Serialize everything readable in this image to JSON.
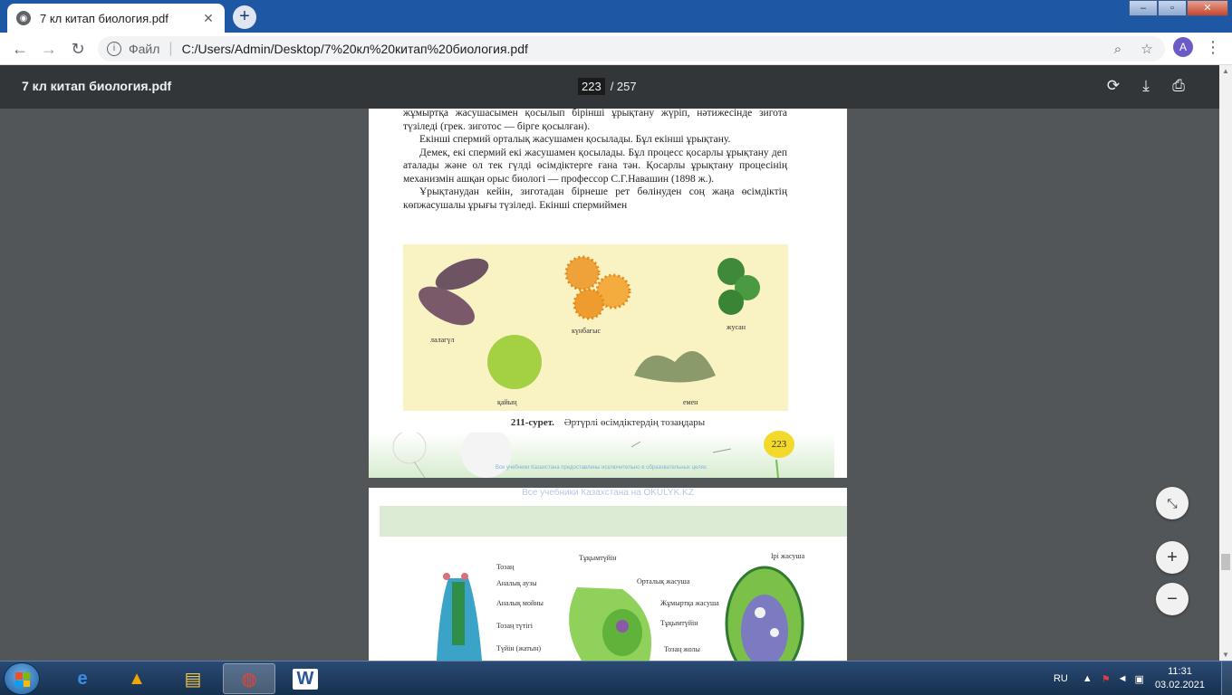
{
  "browser": {
    "tab_title": "7 кл китап биология.pdf",
    "tab_close": "✕",
    "new_tab": "+",
    "favicon": "globe-icon",
    "address_label": "Файл",
    "url": "C:/Users/Admin/Desktop/7%20кл%20китап%20биология.pdf",
    "avatar_letter": "A"
  },
  "pdf_viewer": {
    "file_name": "7 кл китап биология.pdf",
    "current_page": "223",
    "total_pages": "/ 257"
  },
  "page1": {
    "paragraphs": [
      "жұмыртқа жасушасымен қосылып бірінші ұрықтану жүріп, нәтижесінде зигота түзіледі (грек. зиготос — бірге қосылған).",
      "Екінші спермий орталық жасушамен қосылады. Бұл екінші ұрықтану.",
      "Демек, екі спермий екі жасушамен қосылады. Бұл процесс қосарлы ұрықтану деп аталады және ол тек гүлді өсімдіктерге ғана тән. Қосарлы ұрықтану процесінің механизмін ашқан орыс биологі — профессор С.Г.Навашин (1898 ж.).",
      "Ұрықтанудан кейін, зиготадан бірнеше рет бөлінуден соң жаңа өсімдіктің көпжасушалы ұрығы түзіледі. Екінші спермиймен"
    ],
    "pollen_labels": {
      "lalagul": "лалагүл",
      "kunbagys": "күнбағыс",
      "zhusan": "жусан",
      "kaiyn": "қайың",
      "emen": "емен"
    },
    "caption_number": "211-сурет.",
    "caption_text": "Әртүрлі өсімдіктердің тозаңдары",
    "page_number": "223",
    "footer_watermark": "Все учебники Казахстана предоставлены исключительно в образовательных целях"
  },
  "page2": {
    "watermark": "Все учебники Казахстана на OKULYK.KZ",
    "labels_left": [
      "Тозаң",
      "Аналық аузы",
      "Аналық мойны",
      "Тозаң түтігі",
      "Түйін (жатын)"
    ],
    "labels_middle": [
      "Тұқымтүйін",
      "Орталық жасуша",
      "Жұмыртқа жасуша",
      "Тұқымтүйін",
      "Тозаң жолы"
    ],
    "labels_right": [
      "Ірі жасуша"
    ]
  },
  "taskbar": {
    "language": "RU",
    "time": "11:31",
    "date": "03.02.2021"
  },
  "colors": {
    "tab_strip": "#1e58a4",
    "pdf_toolbar": "#323639",
    "viewer_bg": "#525659",
    "pollen_bg": "#f9f2c3"
  }
}
